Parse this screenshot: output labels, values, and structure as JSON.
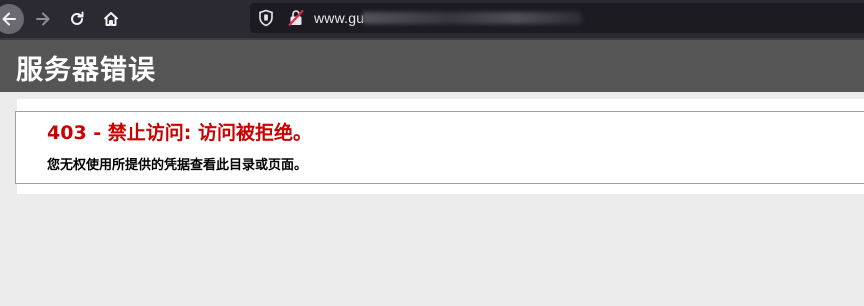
{
  "browser": {
    "url_visible": "www.gu",
    "icons": [
      "back-arrow-icon",
      "forward-arrow-icon",
      "reload-icon",
      "home-icon",
      "shield-icon",
      "insecure-lock-icon"
    ]
  },
  "page": {
    "header_title": "服务器错误",
    "error_title": "403 - 禁止访问: 访问被拒绝。",
    "error_message": "您无权使用所提供的凭据查看此目录或页面。"
  },
  "colors": {
    "toolbar": "#2b2a33",
    "header": "#555555",
    "error_title": "#cc0000"
  }
}
